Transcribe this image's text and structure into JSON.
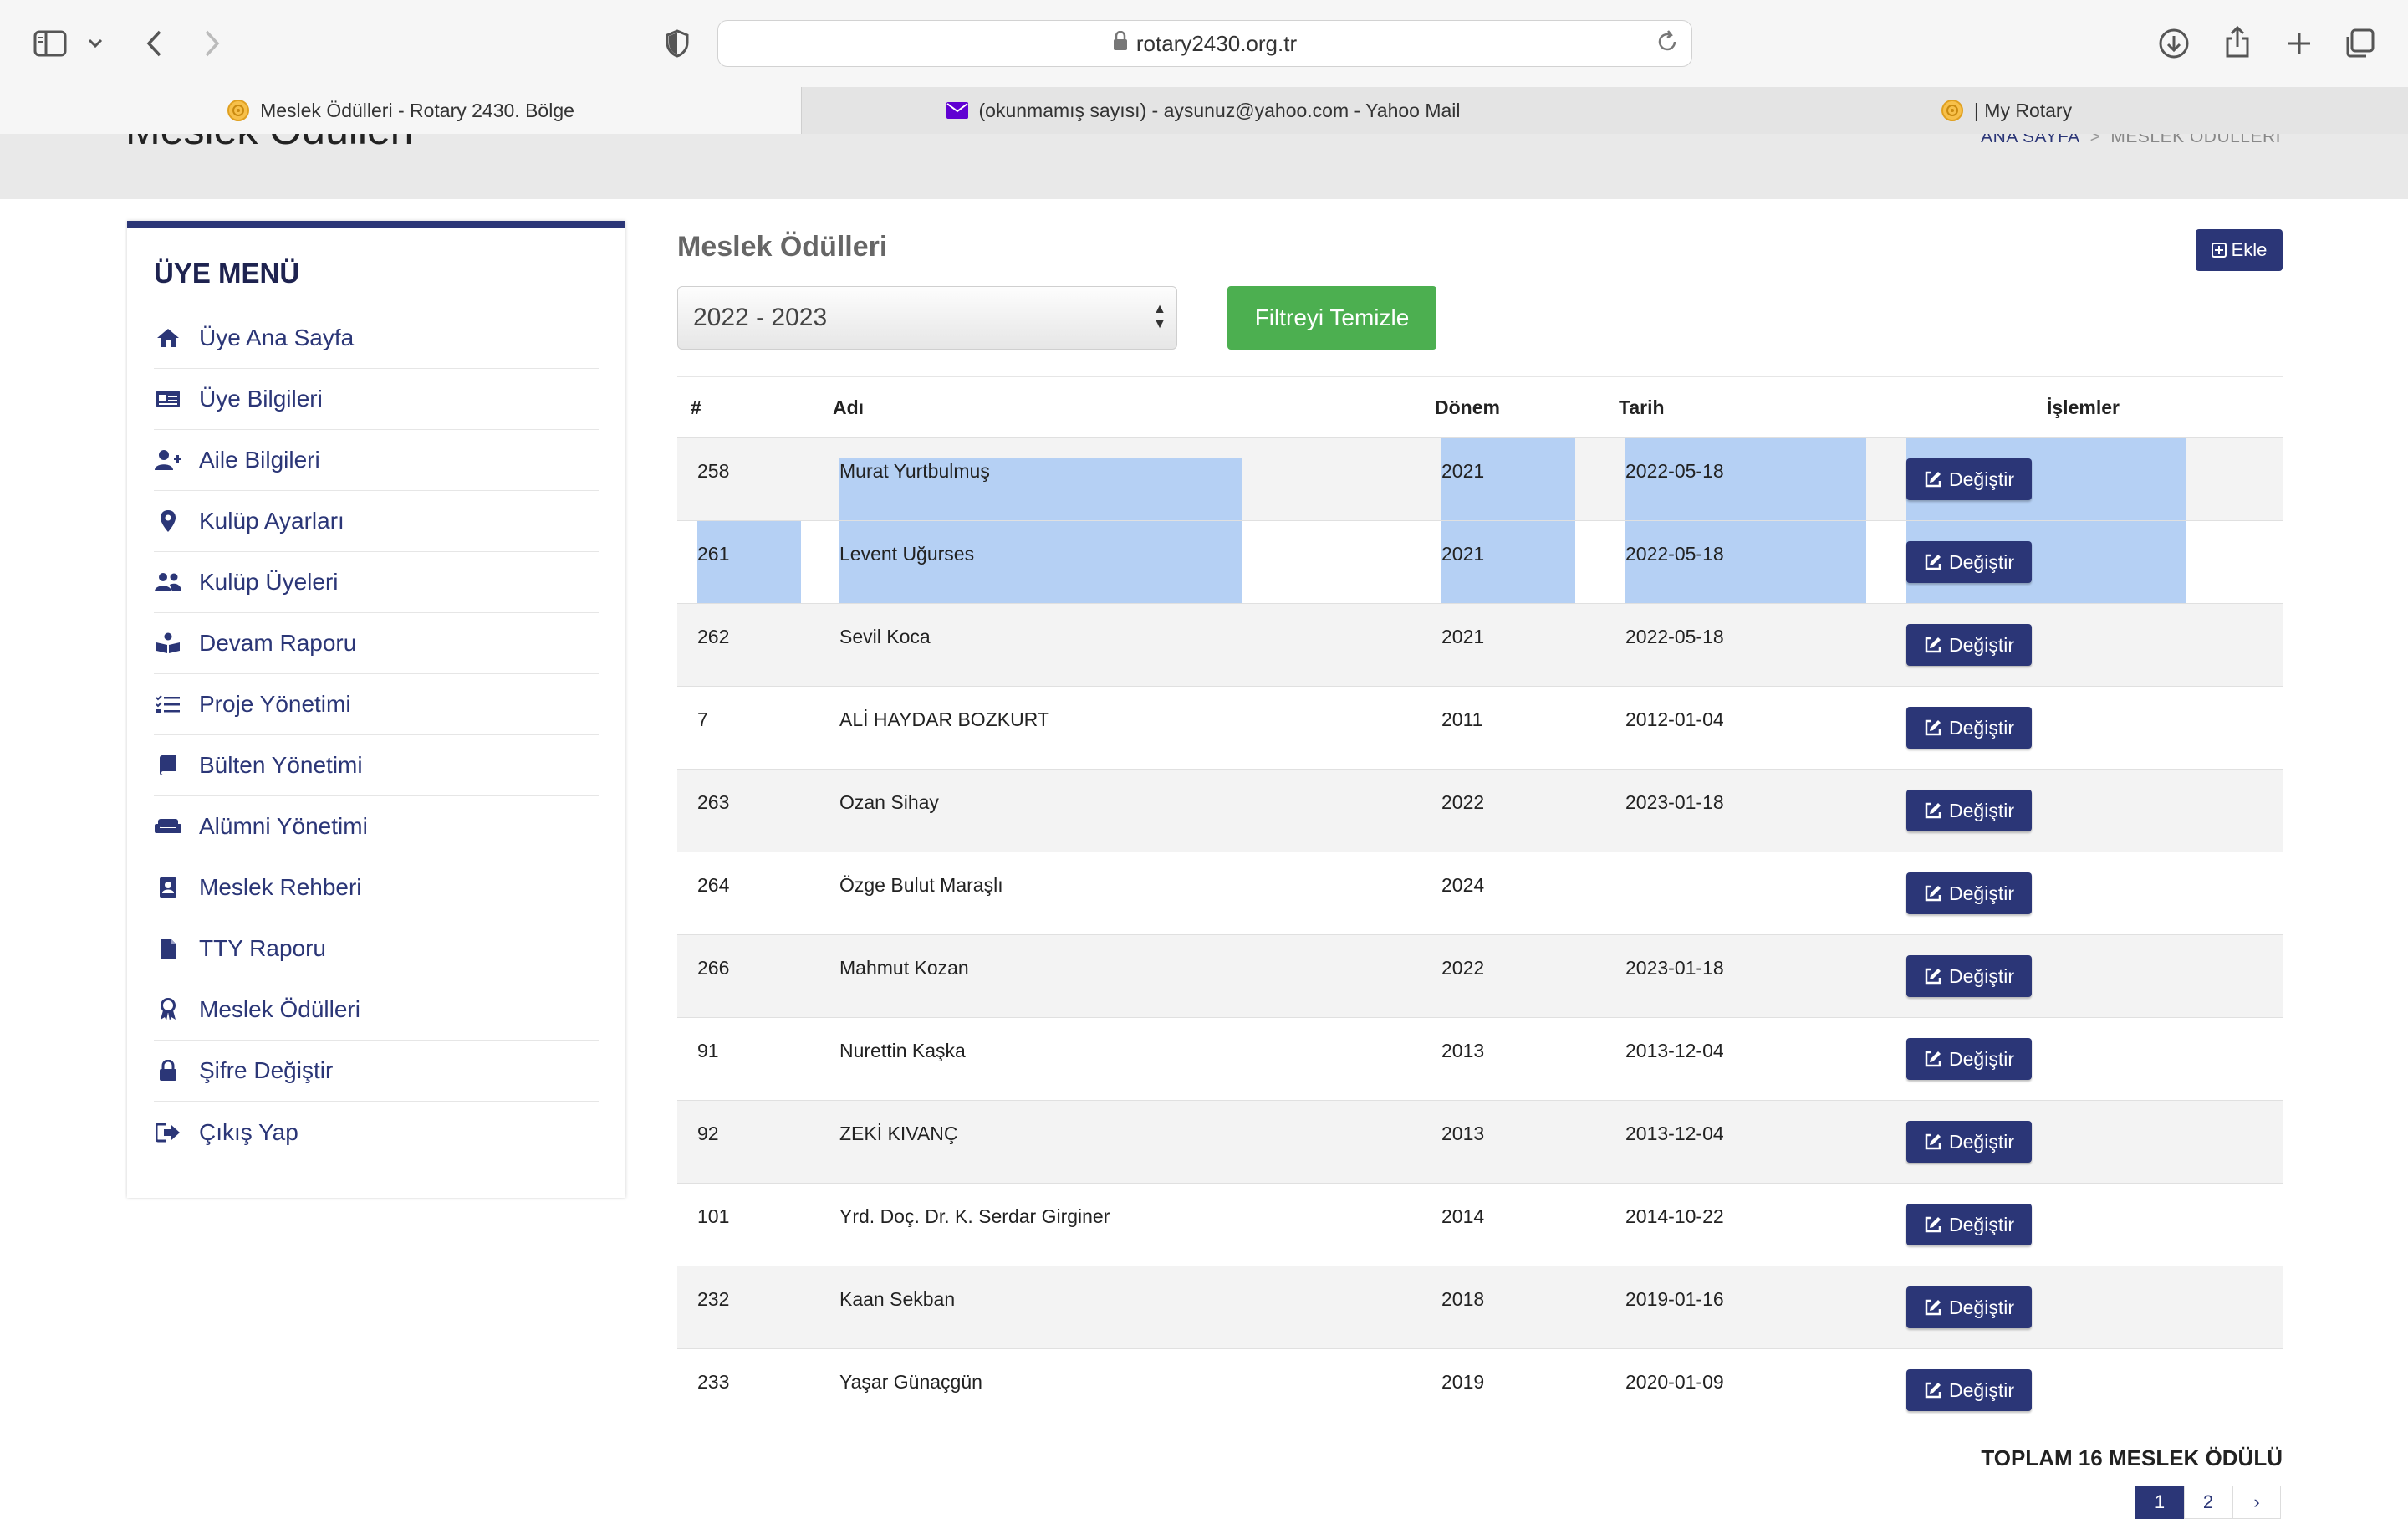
{
  "browser": {
    "url": "rotary2430.org.tr",
    "tabs": [
      {
        "label": "Meslek Ödülleri - Rotary 2430. Bölge",
        "active": true
      },
      {
        "label": "(okunmamış sayısı) - aysunuz@yahoo.com - Yahoo Mail",
        "active": false
      },
      {
        "label": "| My Rotary",
        "active": false
      }
    ]
  },
  "header": {
    "page_title": "Meslek Ödülleri",
    "breadcrumb_home": "ANA SAYFA",
    "breadcrumb_sep": ">",
    "breadcrumb_current": "MESLEK ÖDÜLLERİ"
  },
  "sidebar": {
    "title": "ÜYE MENÜ",
    "items": [
      {
        "label": "Üye Ana Sayfa",
        "icon": "home-icon"
      },
      {
        "label": "Üye Bilgileri",
        "icon": "id-card-icon"
      },
      {
        "label": "Aile Bilgileri",
        "icon": "user-plus-icon"
      },
      {
        "label": "Kulüp Ayarları",
        "icon": "map-marker-icon"
      },
      {
        "label": "Kulüp Üyeleri",
        "icon": "users-icon"
      },
      {
        "label": "Devam Raporu",
        "icon": "reader-icon"
      },
      {
        "label": "Proje Yönetimi",
        "icon": "tasks-icon"
      },
      {
        "label": "Bülten Yönetimi",
        "icon": "book-icon"
      },
      {
        "label": "Alümni Yönetimi",
        "icon": "couch-icon"
      },
      {
        "label": "Meslek Rehberi",
        "icon": "address-book-icon"
      },
      {
        "label": "TTY Raporu",
        "icon": "file-icon"
      },
      {
        "label": "Meslek Ödülleri",
        "icon": "award-icon"
      },
      {
        "label": "Şifre Değiştir",
        "icon": "lock-icon"
      },
      {
        "label": "Çıkış Yap",
        "icon": "sign-out-icon"
      }
    ]
  },
  "main": {
    "title": "Meslek Ödülleri",
    "add_label": "Ekle",
    "period_select": "2022 - 2023",
    "filter_clear_label": "Filtreyi Temizle",
    "columns": [
      "#",
      "Adı",
      "Dönem",
      "Tarih",
      "İşlemler"
    ],
    "edit_label": "Değiştir",
    "rows": [
      {
        "id": "258",
        "name": "Murat Yurtbulmuş",
        "period": "2021",
        "date": "2022-05-18"
      },
      {
        "id": "261",
        "name": "Levent Uğurses",
        "period": "2021",
        "date": "2022-05-18"
      },
      {
        "id": "262",
        "name": "Sevil Koca",
        "period": "2021",
        "date": "2022-05-18"
      },
      {
        "id": "7",
        "name": "ALİ HAYDAR BOZKURT",
        "period": "2011",
        "date": "2012-01-04"
      },
      {
        "id": "263",
        "name": "Ozan Sihay",
        "period": "2022",
        "date": "2023-01-18"
      },
      {
        "id": "264",
        "name": "Özge Bulut Maraşlı",
        "period": "2024",
        "date": ""
      },
      {
        "id": "266",
        "name": "Mahmut Kozan",
        "period": "2022",
        "date": "2023-01-18"
      },
      {
        "id": "91",
        "name": "Nurettin Kaşka",
        "period": "2013",
        "date": "2013-12-04"
      },
      {
        "id": "92",
        "name": "ZEKİ KIVANÇ",
        "period": "2013",
        "date": "2013-12-04"
      },
      {
        "id": "101",
        "name": "Yrd. Doç. Dr. K. Serdar Girginer",
        "period": "2014",
        "date": "2014-10-22"
      },
      {
        "id": "232",
        "name": "Kaan Sekban",
        "period": "2018",
        "date": "2019-01-16"
      },
      {
        "id": "233",
        "name": "Yaşar Günaçgün",
        "period": "2019",
        "date": "2020-01-09"
      }
    ],
    "total_label": "TOPLAM 16 MESLEK ÖDÜLÜ",
    "pagination": [
      "1",
      "2",
      "›"
    ]
  },
  "colors": {
    "brand": "#2b3677",
    "success": "#4caf50",
    "selection": "#b5d0f4"
  }
}
